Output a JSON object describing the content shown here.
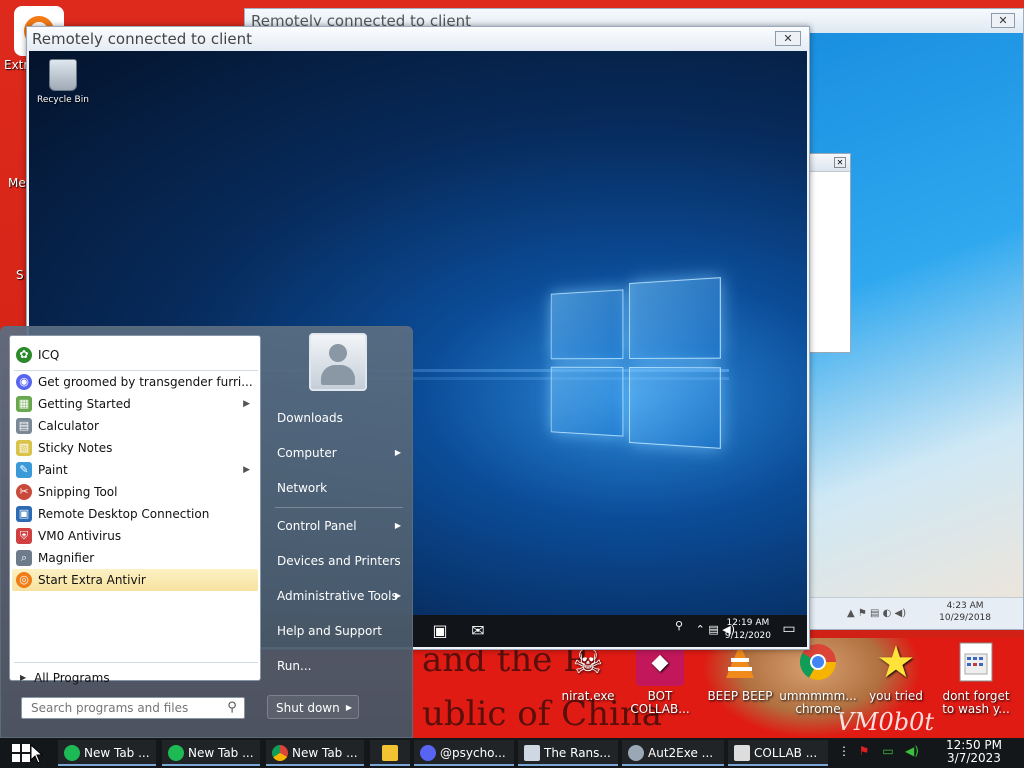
{
  "host": {
    "left_labels": [
      "Extr",
      "Me",
      "S"
    ],
    "banner": {
      "line1": "and the P",
      "line2": "ublic of China",
      "watermark": "VM0b0t"
    },
    "desktop_icons": [
      {
        "label": "nirat.exe",
        "icon": "skull-icon"
      },
      {
        "label": "BOT COLLAB...",
        "icon": "bot-icon"
      },
      {
        "label": "BEEP BEEP",
        "icon": "vlc-cone-icon"
      },
      {
        "label": "ummmmm... chrome",
        "icon": "chrome-icon"
      },
      {
        "label": "you tried",
        "icon": "star-icon"
      },
      {
        "label": "dont forget to wash y...",
        "icon": "calendar-icon"
      }
    ]
  },
  "back_window": {
    "title": "Remotely connected to client",
    "clock_time": "4:23 AM",
    "clock_date": "10/29/2018"
  },
  "front_window": {
    "title": "Remotely connected to client",
    "recycle_bin_label": "Recycle Bin",
    "clock_time": "12:19 AM",
    "clock_date": "9/12/2020"
  },
  "start_menu": {
    "pinned": [
      {
        "label": "ICQ",
        "icon": "icq-icon",
        "color": "#2c8a2c"
      }
    ],
    "recent": [
      {
        "label": "Get groomed by transgender furri...",
        "icon": "discord-icon",
        "color": "#5865f2",
        "submenu": false
      },
      {
        "label": "Getting Started",
        "icon": "getting-started-icon",
        "color": "#6aa84f",
        "submenu": true
      },
      {
        "label": "Calculator",
        "icon": "calculator-icon",
        "color": "#7b8896",
        "submenu": false
      },
      {
        "label": "Sticky Notes",
        "icon": "sticky-notes-icon",
        "color": "#d9c34a",
        "submenu": false
      },
      {
        "label": "Paint",
        "icon": "paint-icon",
        "color": "#3a9ad9",
        "submenu": true
      },
      {
        "label": "Snipping Tool",
        "icon": "snipping-tool-icon",
        "color": "#c94a3a",
        "submenu": false
      },
      {
        "label": "Remote Desktop Connection",
        "icon": "remote-desktop-icon",
        "color": "#2d6cb5",
        "submenu": false
      },
      {
        "label": "VM0 Antivirus",
        "icon": "shield-icon",
        "color": "#d04040",
        "submenu": false
      },
      {
        "label": "Magnifier",
        "icon": "magnifier-icon",
        "color": "#6d7b8a",
        "submenu": false
      },
      {
        "label": "Start Extra Antivir",
        "icon": "antivir-icon",
        "color": "#ef7d17",
        "submenu": false,
        "highlight": true
      }
    ],
    "all_programs": "All Programs",
    "search_placeholder": "Search programs and files",
    "right": [
      {
        "label": "Downloads",
        "submenu": false
      },
      {
        "label": "Computer",
        "submenu": true
      },
      {
        "label": "Network",
        "submenu": false
      },
      {
        "label": "Control Panel",
        "submenu": true
      },
      {
        "label": "Devices and Printers",
        "submenu": false
      },
      {
        "label": "Administrative Tools",
        "submenu": true
      },
      {
        "label": "Help and Support",
        "submenu": false
      },
      {
        "label": "Run...",
        "submenu": false
      }
    ],
    "shutdown": "Shut down"
  },
  "taskbar": {
    "items": [
      {
        "label": "New Tab ...",
        "icon": "spotify-icon",
        "color": "#1db954"
      },
      {
        "label": "New Tab ...",
        "icon": "spotify-icon",
        "color": "#1db954"
      },
      {
        "label": "New Tab ...",
        "icon": "chrome-icon",
        "color": "#e8b018"
      },
      {
        "label": "",
        "icon": "folder-icon",
        "color": "#f1c232"
      },
      {
        "label": "@psycho...",
        "icon": "discord-icon",
        "color": "#5865f2"
      },
      {
        "label": "The Rans...",
        "icon": "window-icon",
        "color": "#cfd8e2"
      },
      {
        "label": "Aut2Exe ...",
        "icon": "autoit-icon",
        "color": "#9aa7b4"
      },
      {
        "label": "COLLAB ...",
        "icon": "skull-icon",
        "color": "#dddddd"
      }
    ],
    "clock_time": "12:50 PM",
    "clock_date": "3/7/2023"
  }
}
